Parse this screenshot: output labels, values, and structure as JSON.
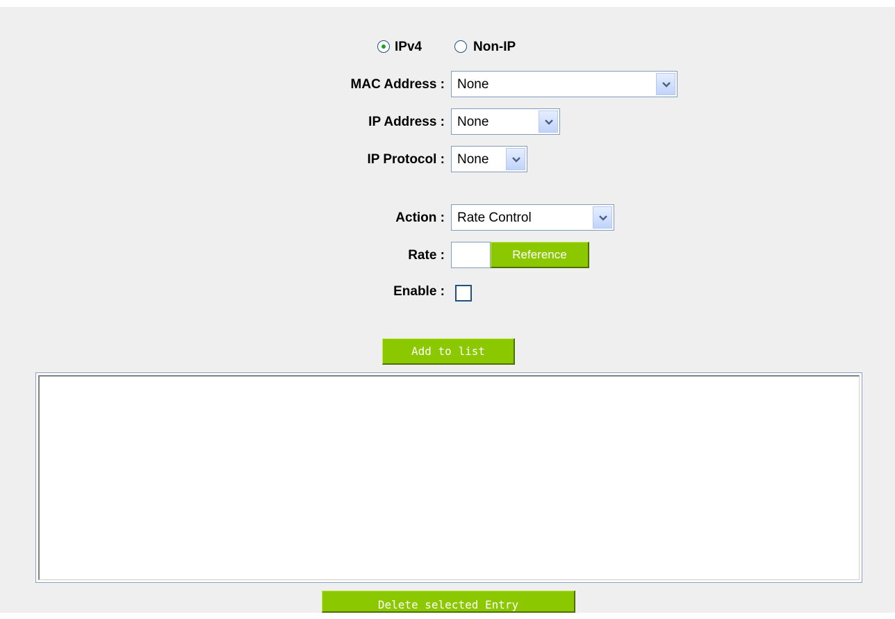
{
  "protocol": {
    "options": [
      {
        "label": "IPv4",
        "selected": true
      },
      {
        "label": "Non-IP",
        "selected": false
      }
    ]
  },
  "form": {
    "mac_address": {
      "label": "MAC Address :",
      "value": "None"
    },
    "ip_address": {
      "label": "IP Address :",
      "value": "None"
    },
    "ip_protocol": {
      "label": "IP Protocol :",
      "value": "None"
    },
    "action": {
      "label": "Action :",
      "value": "Rate Control"
    },
    "rate": {
      "label": "Rate :",
      "value": "",
      "reference_label": "Reference"
    },
    "enable": {
      "label": "Enable :",
      "checked": false
    }
  },
  "buttons": {
    "add_to_list": "Add to list",
    "delete_selected": "Delete selected Entry"
  },
  "entries_list": {
    "items": []
  },
  "colors": {
    "panel_background": "#efefef",
    "button_green": "#8cc800",
    "radio_selected_dot": "#21a121",
    "input_border": "#7f9db9"
  },
  "icons": {
    "dropdown": "chevron-down-icon",
    "radio": "radio-icon",
    "checkbox": "checkbox-icon"
  }
}
